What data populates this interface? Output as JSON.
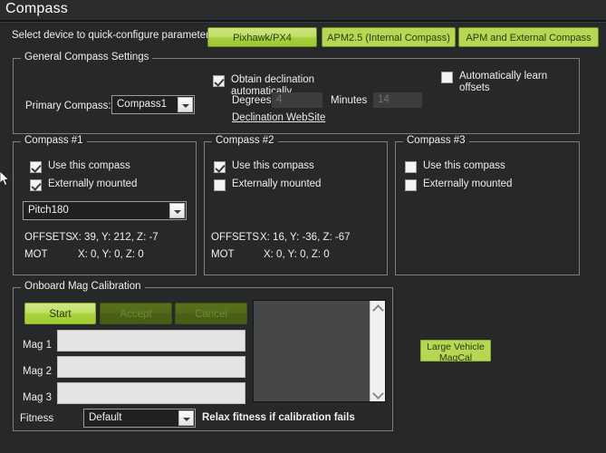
{
  "window": {
    "title": "Compass"
  },
  "quick_config": {
    "label": "Select device to quick-configure parameters",
    "buttons": [
      {
        "label": "Pixhawk/PX4"
      },
      {
        "label": "APM2.5 (Internal Compass)"
      },
      {
        "label": "APM and External Compass"
      }
    ]
  },
  "general": {
    "group_label": "General Compass Settings",
    "primary_compass_label": "Primary Compass:",
    "primary_compass_value": "Compass1",
    "obtain_declination_label": "Obtain declination automatically",
    "obtain_declination_checked": true,
    "degrees_label": "Degrees",
    "degrees_value": "4",
    "minutes_label": "Minutes",
    "minutes_value": "14",
    "declination_website_link": "Declination WebSite",
    "auto_learn_label": "Automatically learn offsets",
    "auto_learn_checked": false
  },
  "compasses": [
    {
      "group_label": "Compass #1",
      "use_label": "Use this compass",
      "use_checked": true,
      "external_label": "Externally mounted",
      "external_checked": true,
      "orientation_value": "Pitch180",
      "has_orientation": true,
      "offsets_label": "OFFSETS",
      "offsets_value": "X: 39,   Y: 212,   Z: -7",
      "mot_label": "MOT",
      "mot_value": "X: 0,   Y: 0,   Z: 0",
      "has_values": true
    },
    {
      "group_label": "Compass #2",
      "use_label": "Use this compass",
      "use_checked": true,
      "external_label": "Externally mounted",
      "external_checked": false,
      "orientation_value": "",
      "has_orientation": false,
      "offsets_label": "OFFSETS",
      "offsets_value": "X: 16,   Y: -36,   Z: -67",
      "mot_label": "MOT",
      "mot_value": "X: 0,   Y: 0,   Z: 0",
      "has_values": true
    },
    {
      "group_label": "Compass #3",
      "use_label": "Use this compass",
      "use_checked": false,
      "external_label": "Externally mounted",
      "external_checked": false,
      "orientation_value": "",
      "has_orientation": false,
      "offsets_label": "",
      "offsets_value": "",
      "mot_label": "",
      "mot_value": "",
      "has_values": false
    }
  ],
  "onboard_cal": {
    "group_label": "Onboard Mag Calibration",
    "start_label": "Start",
    "accept_label": "Accept",
    "cancel_label": "Cancel",
    "mag_labels": [
      "Mag 1",
      "Mag 2",
      "Mag 3"
    ],
    "mag_progress": [
      0,
      0,
      0
    ],
    "fitness_label": "Fitness",
    "fitness_value": "Default",
    "relax_hint": "Relax fitness if calibration fails",
    "log_entries": []
  },
  "large_vehicle": {
    "label": "Large Vehicle\nMagCal"
  },
  "colors": {
    "background": "#262829",
    "accent_green": "#b5d754",
    "accent_green_bright": "#bfe064",
    "disabled_green": "#52691a",
    "text": "#efefef",
    "group_border": "#7d7f80"
  }
}
